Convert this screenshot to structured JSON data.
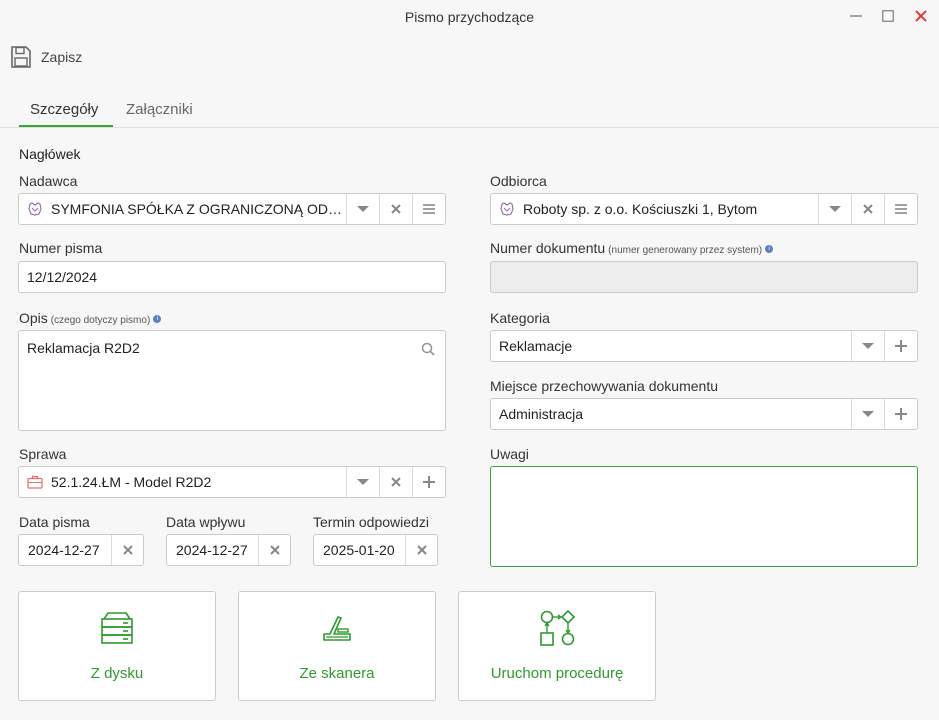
{
  "window": {
    "title": "Pismo przychodzące"
  },
  "toolbar": {
    "save_label": "Zapisz"
  },
  "tabs": [
    {
      "label": "Szczegóły",
      "active": true
    },
    {
      "label": "Załączniki",
      "active": false
    }
  ],
  "section": {
    "header": "Nagłówek"
  },
  "form": {
    "nadawca": {
      "label": "Nadawca",
      "value": "SYMFONIA SPÓŁKA Z OGRANICZONĄ ODPOWIEDZIALNOŚCIĄ"
    },
    "odbiorca": {
      "label": "Odbiorca",
      "value": "Roboty sp. z o.o. Kościuszki 1, Bytom"
    },
    "numer_pisma": {
      "label": "Numer pisma",
      "value": "12/12/2024"
    },
    "numer_dokumentu": {
      "label": "Numer dokumentu",
      "hint": "(numer generowany przez system)",
      "value": ""
    },
    "opis": {
      "label": "Opis",
      "hint": "(czego dotyczy pismo)",
      "value": "Reklamacja R2D2"
    },
    "kategoria": {
      "label": "Kategoria",
      "value": "Reklamacje"
    },
    "miejsce": {
      "label": "Miejsce przechowywania dokumentu",
      "value": "Administracja"
    },
    "sprawa": {
      "label": "Sprawa",
      "value": "52.1.24.ŁM - Model R2D2"
    },
    "uwagi": {
      "label": "Uwagi",
      "value": ""
    },
    "data_pisma": {
      "label": "Data pisma",
      "value": "2024-12-27"
    },
    "data_wplywu": {
      "label": "Data wpływu",
      "value": "2024-12-27"
    },
    "termin": {
      "label": "Termin odpowiedzi",
      "value": "2025-01-20"
    }
  },
  "actions": {
    "dysk": {
      "label": "Z dysku",
      "icon": "server-icon"
    },
    "skaner": {
      "label": "Ze skanera",
      "icon": "scanner-icon"
    },
    "procedura": {
      "label": "Uruchom procedurę",
      "icon": "workflow-icon"
    }
  },
  "colors": {
    "accent": "#3aa33a",
    "close": "#e03a3a",
    "entity_icon": "#9b6fb0",
    "case_icon": "#e07070"
  }
}
